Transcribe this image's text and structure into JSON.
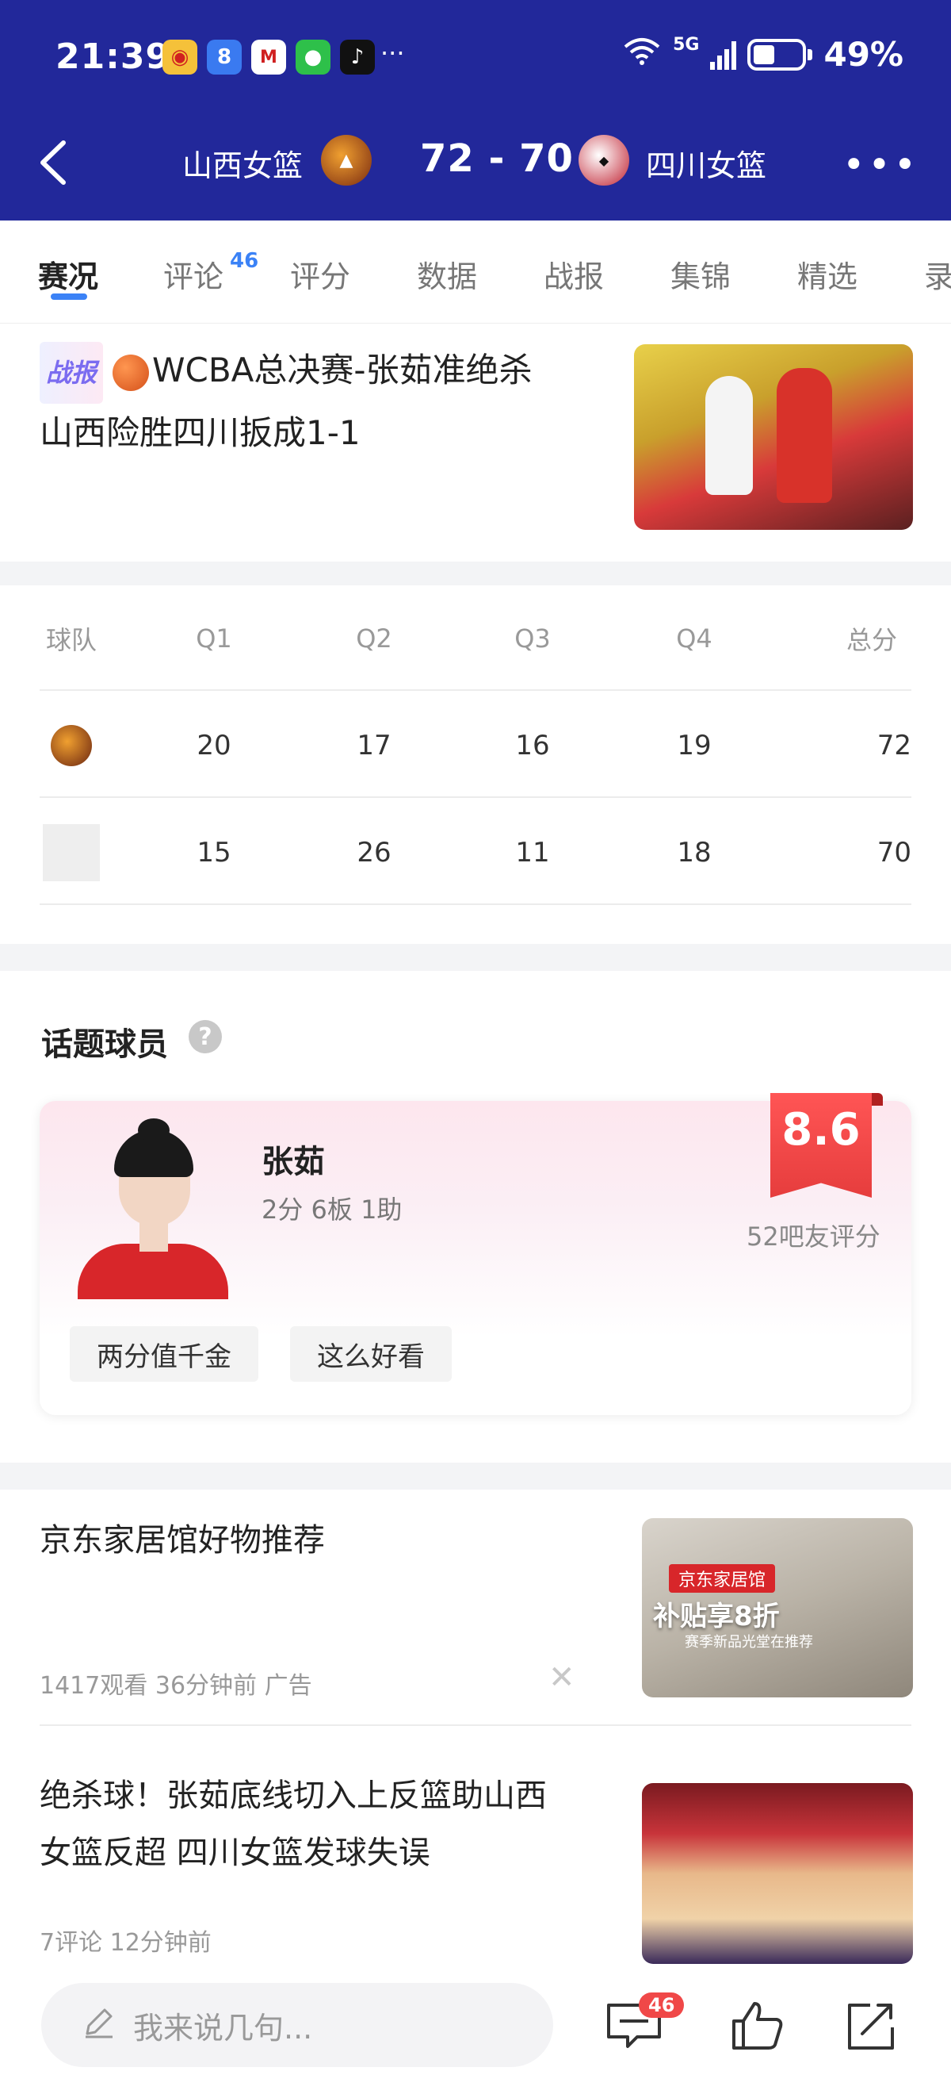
{
  "status_bar": {
    "time": "21:39",
    "app_icons": [
      "weibo-icon",
      "app-8-icon",
      "news-app-icon",
      "wechat-icon",
      "douyin-icon"
    ],
    "more_indicator": "···",
    "network_label": "5G",
    "battery_percent": "49%"
  },
  "header": {
    "team_left": "山西女篮",
    "score": "72 - 70",
    "team_right": "四川女篮",
    "bg_color": "#22289a"
  },
  "tabs": [
    {
      "label": "赛况",
      "active": true
    },
    {
      "label": "评论",
      "badge": "46"
    },
    {
      "label": "评分"
    },
    {
      "label": "数据"
    },
    {
      "label": "战报"
    },
    {
      "label": "集锦"
    },
    {
      "label": "精选"
    },
    {
      "label": "录"
    }
  ],
  "news_top": {
    "tag": "战报",
    "title_line1": "WCBA总决赛-张茹准绝杀",
    "title_line2": "山西险胜四川扳成1-1"
  },
  "score_table": {
    "headers": [
      "球队",
      "Q1",
      "Q2",
      "Q3",
      "Q4",
      "总分"
    ],
    "rows": [
      {
        "team_icon": "shanxi-logo",
        "values": [
          "20",
          "17",
          "16",
          "19",
          "72"
        ]
      },
      {
        "team_icon": "blank-logo",
        "values": [
          "15",
          "26",
          "11",
          "18",
          "70"
        ]
      }
    ]
  },
  "topic_player": {
    "section_title": "话题球员",
    "name": "张茹",
    "stats": "2分 6板 1助",
    "rating": "8.6",
    "rating_label": "52吧友评分",
    "chips": [
      "两分值千金",
      "这么好看"
    ]
  },
  "feed": [
    {
      "title": "京东家居馆好物推荐",
      "meta": "1417观看   36分钟前   广告",
      "thumb_tag": "京东家居馆",
      "thumb_big": "补贴享8折",
      "thumb_small": "赛季新品光堂在推荐"
    },
    {
      "title_line1": "绝杀球！张茹底线切入上反篮助山西",
      "title_line2": "女篮反超 四川女篮发球失误",
      "meta": "7评论   12分钟前"
    }
  ],
  "bottom_bar": {
    "input_placeholder": "我来说几句...",
    "comment_badge": "46"
  }
}
